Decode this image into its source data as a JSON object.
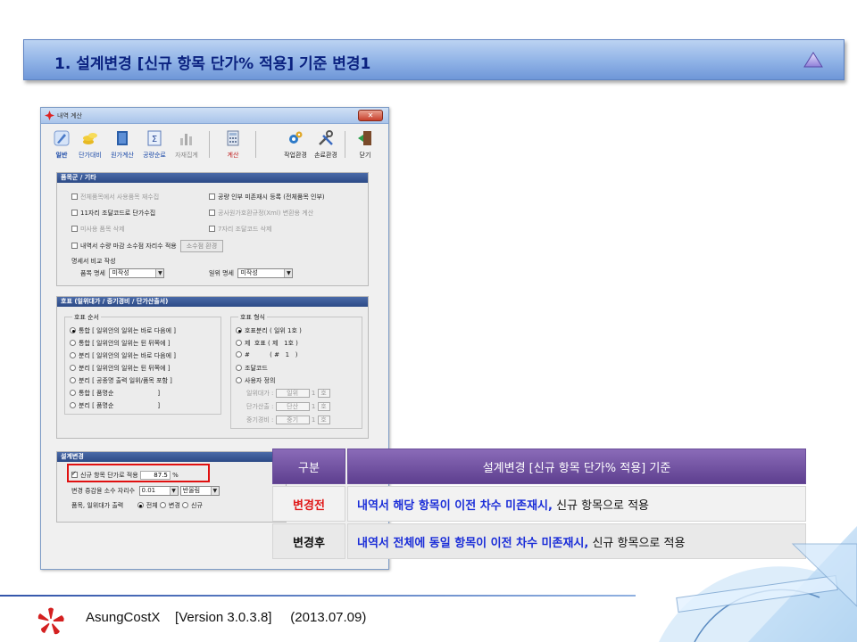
{
  "banner": {
    "title": "1. 설계변경 [신규 항목 단가% 적용] 기준 변경1"
  },
  "window": {
    "title": "내역 계산",
    "toolbar": [
      {
        "label": "일반",
        "icon": "pencil-icon"
      },
      {
        "label": "단가대비",
        "icon": "coins-icon"
      },
      {
        "label": "원가계산",
        "icon": "ledger-icon"
      },
      {
        "label": "공량순료",
        "icon": "sigma-doc-icon"
      },
      {
        "label": "자재집계",
        "icon": "bar-chart-icon"
      },
      {
        "label": "계산",
        "icon": "calculator-icon"
      },
      {
        "label": "작업환경",
        "icon": "gears-icon"
      },
      {
        "label": "손료환경",
        "icon": "tools-icon"
      },
      {
        "label": "닫기",
        "icon": "exit-door-icon"
      }
    ],
    "panel1": {
      "header": "품목군 / 기타",
      "opt_all_items": "전체품목에서 사용품목 재수집",
      "opt_labor": "공량 인부 미존재시 등록 (전체품목 인부)",
      "opt_11digit": "11자리 조달코드로 단가수집",
      "opt_cost": "공사원가호환규정(Xml) 변환용 계산",
      "opt_unused": "미사용 품목 삭제",
      "opt_7digit": "7자리 조달코드 삭제",
      "opt_decimal": "내역서 수량 마감 소수점 자리수 적용",
      "btn_decimal": "소수점 환경",
      "spec_title": "명세서 비교 작성",
      "item_spec_label": "품목 명세",
      "item_spec_value": "미작성",
      "unit_spec_label": "일위 명세",
      "unit_spec_value": "미작성"
    },
    "panel2": {
      "header": "호표 (일위대가 / 중기경비 / 단가산출서)",
      "order_title": "호표 순서",
      "orders": [
        "통합 [ 일위안의 일위는 바로 다음에 ]",
        "통합 [ 일위안의 일위는 뒨     뒤쪽에 ]",
        "분리 [ 일위안의 일위는 바로 다음에 ]",
        "분리 [ 일위안의 일위는 뒨     뒤쪽에 ]",
        "분리 [ 공종명 출력 일위/품목 포함  ]",
        "통합 [ 품명순                      ]",
        "분리 [ 품명순                      ]"
      ],
      "format_title": "호표 형식",
      "formats": [
        "호표분리 ( 일위 1호 )",
        "제  호표 ( 제   1호 )",
        "#          ( #   1   )",
        "조달코드",
        "사용자 정의"
      ],
      "custom_rows": [
        {
          "label": "일위대가 :",
          "value": "일위",
          "num": "1",
          "unit": "호"
        },
        {
          "label": "단가산출 :",
          "value": "단산",
          "num": "1",
          "unit": "호"
        },
        {
          "label": "중기경비 :",
          "value": "중기",
          "num": "1",
          "unit": "호"
        }
      ]
    },
    "panel3": {
      "header": "설계변경",
      "new_item_label": "신규 항목 단가로 적용",
      "new_item_value": "87.5",
      "new_item_unit": "%",
      "decimal_label": "변경 증감율 소수 자리수",
      "decimal_value": "0.01",
      "round_value": "반올림",
      "unit_price_label": "품목, 일위대가 출력",
      "radio_all": "전체",
      "radio_change": "변경",
      "radio_new": "신규"
    }
  },
  "table": {
    "header_col1": "구분",
    "header_col2": "설계변경 [신규 항목 단가% 적용] 기준",
    "row_before_label": "변경전",
    "row_before_em": "내역서 해당 항목이 이전 차수 미존재시,",
    "row_before_rest": " 신규 항목으로 적용",
    "row_after_label": "변경후",
    "row_after_em": "내역서 전체에 동일 항목이 이전 차수 미존재시,",
    "row_after_rest": " 신규 항목으로 적용"
  },
  "footer": {
    "text": "AsungCostX    [Version 3.0.3.8]     (2013.07.09)"
  },
  "colors": {
    "banner_text": "#0b2280",
    "table_header": "#5e3f8f",
    "highlight_red": "#e01818",
    "emphasis_blue": "#1a2dd8"
  }
}
